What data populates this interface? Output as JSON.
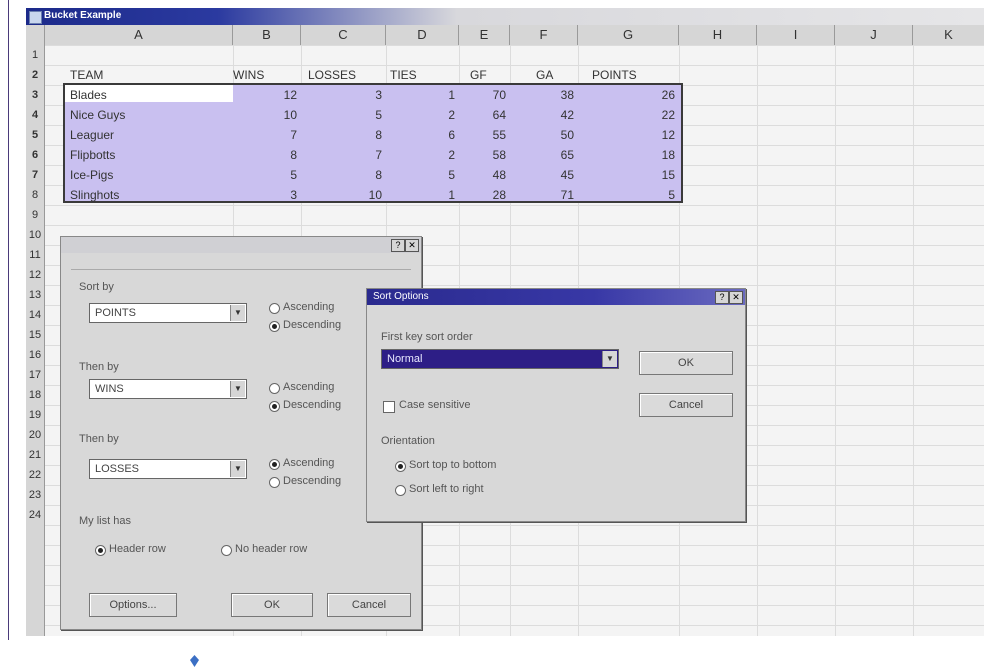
{
  "window": {
    "title": "Bucket Example"
  },
  "columns": [
    "A",
    "B",
    "C",
    "D",
    "E",
    "F",
    "G",
    "H",
    "I",
    "J",
    "K"
  ],
  "rows": [
    "1",
    "2",
    "3",
    "4",
    "5",
    "6",
    "7",
    "8",
    "9",
    "10",
    "11",
    "12",
    "13",
    "14",
    "15",
    "16",
    "17",
    "18",
    "19",
    "20",
    "21",
    "22",
    "23",
    "24"
  ],
  "sheet": {
    "headers": [
      "TEAM",
      "WINS",
      "LOSSES",
      "TIES",
      "GF",
      "GA",
      "POINTS"
    ],
    "data": [
      [
        "Blades",
        "12",
        "3",
        "1",
        "70",
        "38",
        "26"
      ],
      [
        "Nice Guys",
        "10",
        "5",
        "2",
        "64",
        "42",
        "22"
      ],
      [
        "Leaguer",
        "7",
        "8",
        "6",
        "55",
        "50",
        "12"
      ],
      [
        "Flipbotts",
        "8",
        "7",
        "2",
        "58",
        "65",
        "18"
      ],
      [
        "Ice-Pigs",
        "5",
        "8",
        "5",
        "48",
        "45",
        "15"
      ],
      [
        "Slinghots",
        "3",
        "10",
        "1",
        "28",
        "71",
        "5"
      ]
    ]
  },
  "sort_dialog": {
    "sort_by_label": "Sort by",
    "sort_by_value": "POINTS",
    "sort_by_asc": "Ascending",
    "sort_by_desc": "Descending",
    "then_by_label": "Then by",
    "then_by_value": "WINS",
    "then_by_asc": "Ascending",
    "then_by_desc": "Descending",
    "then_by2_label": "Then by",
    "then_by2_value": "LOSSES",
    "then_by2_asc": "Ascending",
    "then_by2_desc": "Descending",
    "my_list_label": "My list has",
    "header_row": "Header row",
    "no_header_row": "No header row",
    "options_button": "Options...",
    "ok_button": "OK",
    "cancel_button": "Cancel"
  },
  "options_dialog": {
    "title": "Sort Options",
    "first_key_label": "First key sort order",
    "first_key_value": "Normal",
    "ok_button": "OK",
    "cancel_button": "Cancel",
    "case_sensitive": "Case sensitive",
    "orientation_label": "Orientation",
    "top_to_bottom": "Sort top to bottom",
    "left_to_right": "Sort left to right"
  },
  "colors": {
    "selection": "#c9c0f0",
    "title_bar": "#1c2a8a",
    "active_list": "#2d1e86"
  }
}
